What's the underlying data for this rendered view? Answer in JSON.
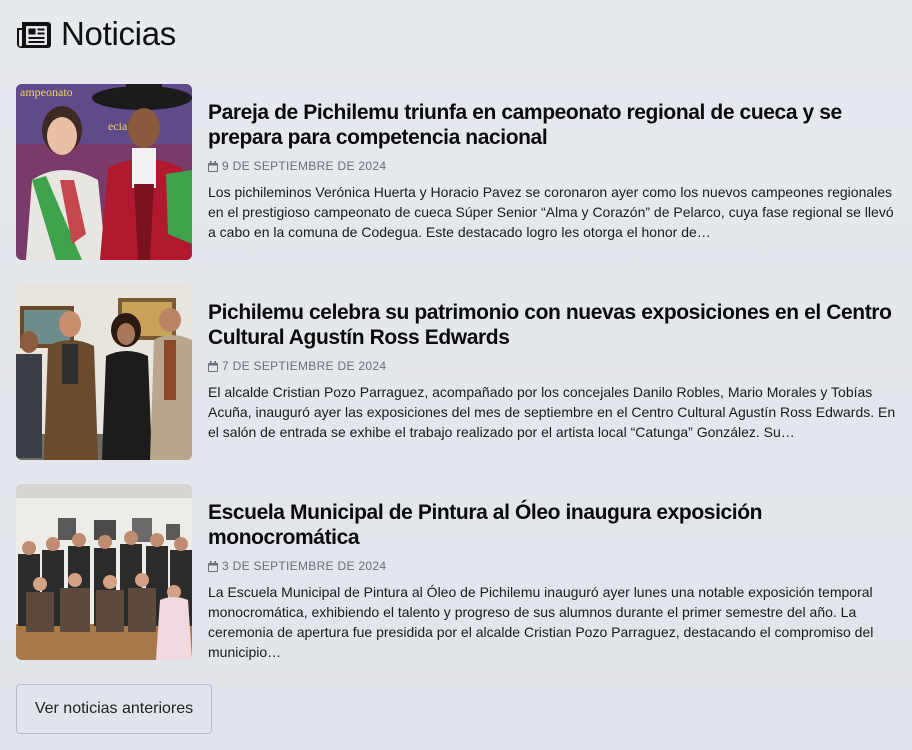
{
  "header": {
    "title": "Noticias",
    "icon": "newspaper-icon"
  },
  "articles": [
    {
      "title": "Pareja de Pichilemu triunfa en campeonato regional de cueca y se prepara para competencia nacional",
      "date": "9 DE SEPTIEMBRE DE 2024",
      "excerpt": "Los pichileminos Verónica Huerta y Horacio Pavez se coronaron ayer como los nuevos campeones regionales en el prestigioso campeonato de cueca Súper Senior “Alma y Corazón” de Pelarco, cuya fase regional se llevó a cabo en la comuna de Codegua. Este destacado logro les otorga el honor de…",
      "image_banner_text": "ampeonato",
      "image_banner_text2": "ecia Sa"
    },
    {
      "title": "Pichilemu celebra su patrimonio con nuevas exposiciones en el Centro Cultural Agustín Ross Edwards",
      "date": "7 DE SEPTIEMBRE DE 2024",
      "excerpt": "El alcalde Cristian Pozo Parraguez, acompañado por los concejales Danilo Robles, Mario Morales y Tobías Acuña, inauguró ayer las exposiciones del mes de septiembre en el Centro Cultural Agustín Ross Edwards. En el salón de entrada se exhibe el trabajo realizado por el artista local “Catunga” González. Su…"
    },
    {
      "title": "Escuela Municipal de Pintura al Óleo inaugura exposición monocromática",
      "date": "3 DE SEPTIEMBRE DE 2024",
      "excerpt": "La Escuela Municipal de Pintura al Óleo de Pichilemu inauguró ayer lunes una notable exposición temporal monocromática, exhibiendo el talento y progreso de sus alumnos durante el primer semestre del año. La ceremonia de apertura fue presidida por el alcalde Cristian Pozo Parraguez, destacando el compromiso del municipio…"
    }
  ],
  "more_button": {
    "label": "Ver noticias anteriores"
  }
}
